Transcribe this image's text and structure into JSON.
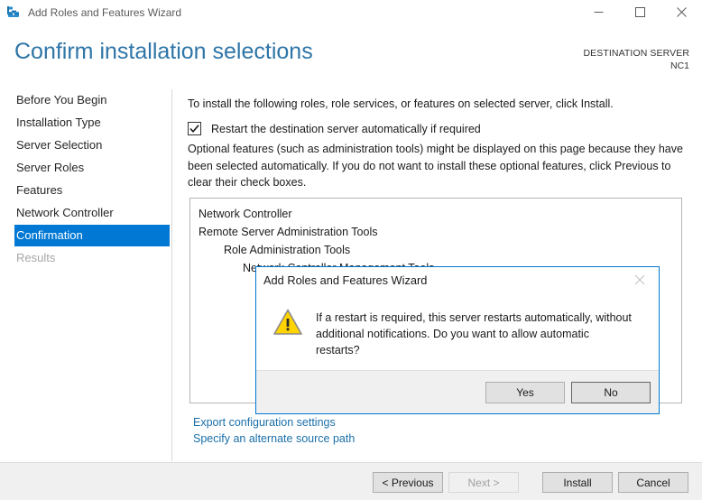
{
  "window": {
    "title": "Add Roles and Features Wizard",
    "icon": "wizard-toolbox-icon",
    "controls": {
      "minimize": "minimize-icon",
      "maximize": "maximize-icon",
      "close": "close-icon"
    }
  },
  "header": {
    "page_title": "Confirm installation selections",
    "destination_label": "DESTINATION SERVER",
    "destination_value": "NC1",
    "title_color": "#2e75a8"
  },
  "sidebar": {
    "items": [
      {
        "label": "Before You Begin",
        "state": "normal"
      },
      {
        "label": "Installation Type",
        "state": "normal"
      },
      {
        "label": "Server Selection",
        "state": "normal"
      },
      {
        "label": "Server Roles",
        "state": "normal"
      },
      {
        "label": "Features",
        "state": "normal"
      },
      {
        "label": "Network Controller",
        "state": "normal"
      },
      {
        "label": "Confirmation",
        "state": "selected"
      },
      {
        "label": "Results",
        "state": "disabled"
      }
    ],
    "selected_color": "#0078d4"
  },
  "main": {
    "intro": "To install the following roles, role services, or features on selected server, click Install.",
    "restart_checkbox": {
      "label": "Restart the destination server automatically if required",
      "checked": true
    },
    "optional_note": "Optional features (such as administration tools) might be displayed on this page because they have been selected automatically. If you do not want to install these optional features, click Previous to clear their check boxes.",
    "listbox": [
      {
        "text": "Network Controller",
        "level": 0
      },
      {
        "text": "Remote Server Administration Tools",
        "level": 1
      },
      {
        "text": "Role Administration Tools",
        "level": 2
      },
      {
        "text": "Network Controller Management Tools",
        "level": 3
      }
    ],
    "links": [
      "Export configuration settings",
      "Specify an alternate source path"
    ],
    "link_color": "#1a6fa8"
  },
  "footer": {
    "buttons": [
      {
        "label": "< Previous",
        "state": "enabled"
      },
      {
        "label": "Next >",
        "state": "disabled"
      },
      {
        "label": "Install",
        "state": "enabled"
      },
      {
        "label": "Cancel",
        "state": "enabled"
      }
    ]
  },
  "dialog": {
    "title": "Add Roles and Features Wizard",
    "close_icon": "close-icon",
    "warning_icon": "warning-triangle-icon",
    "message": "If a restart is required, this server restarts automatically, without additional notifications. Do you want to allow automatic restarts?",
    "buttons": [
      {
        "label": "Yes",
        "default": false
      },
      {
        "label": "No",
        "default": true
      }
    ],
    "border_color": "#0078d4",
    "warning_color": "#ffd000"
  }
}
